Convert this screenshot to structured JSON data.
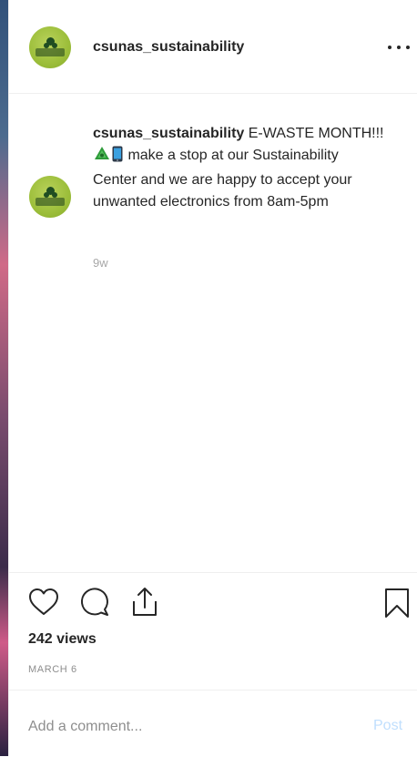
{
  "header": {
    "username": "csunas_sustainability",
    "more_icon": "more-horizontal-icon"
  },
  "caption": {
    "username": "csunas_sustainability",
    "text_part1": "E-WASTE MONTH!!!",
    "emojis": [
      "recycle-emoji",
      "mobile-phone-emoji"
    ],
    "text_part2": "make a stop at our Sustainability Center and we are happy to accept your unwanted electronics from 8am-5pm",
    "time": "9w"
  },
  "actions": {
    "icons": [
      "heart-icon",
      "comment-icon",
      "share-icon",
      "bookmark-icon"
    ],
    "views": "242 views",
    "date": "MARCH 6"
  },
  "comment": {
    "placeholder": "Add a comment...",
    "post_label": "Post"
  },
  "colors": {
    "text": "#262626",
    "muted": "#8e8e8e",
    "post_disabled": "#c0dffd",
    "avatar_green": "#9cbe3a"
  }
}
